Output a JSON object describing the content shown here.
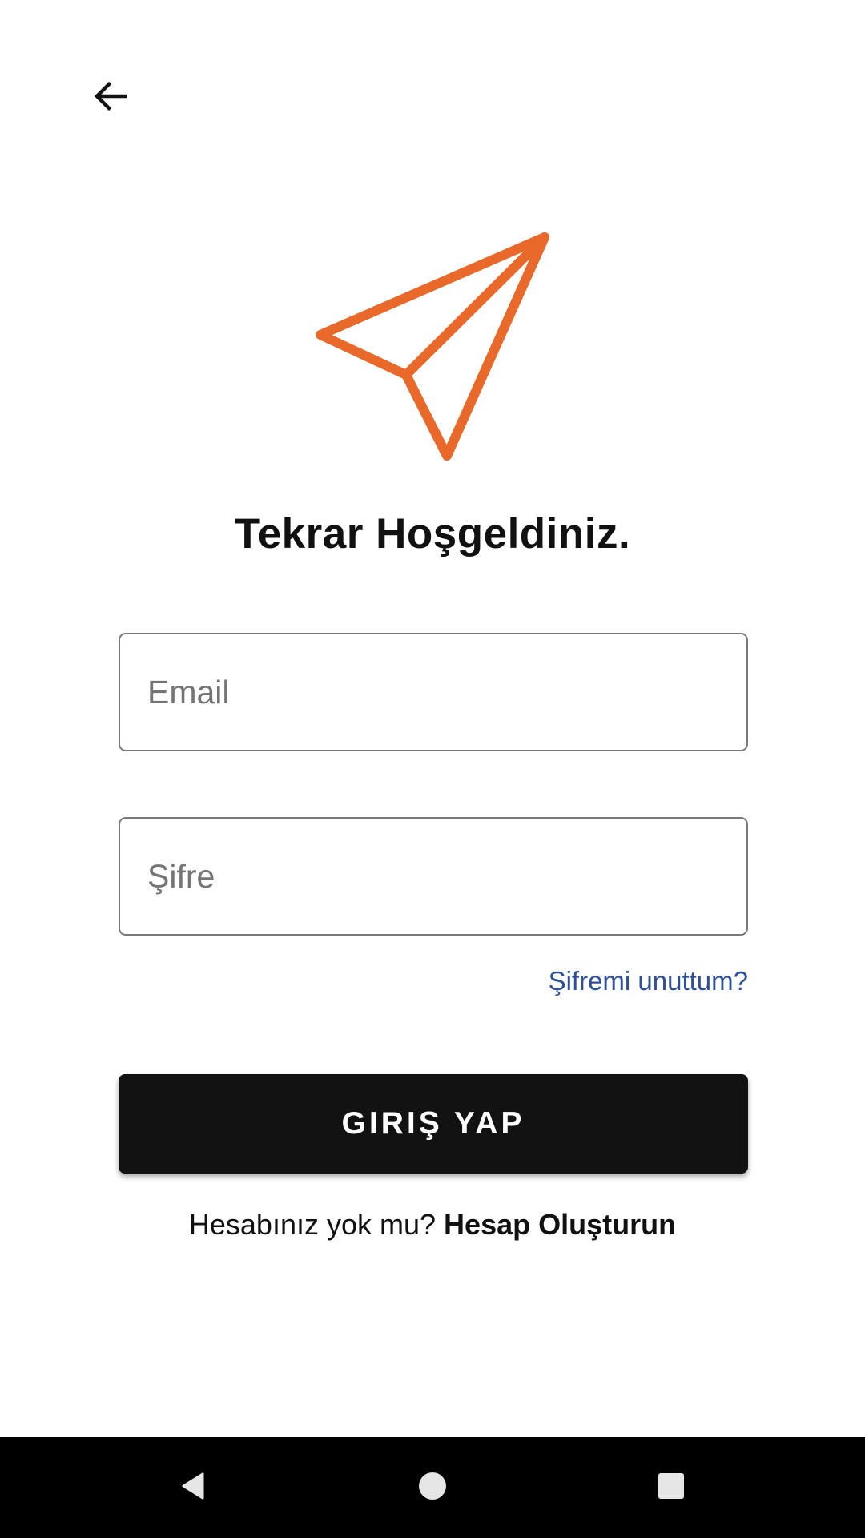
{
  "header": {
    "back_icon": "arrow-left-icon"
  },
  "logo": {
    "icon": "paper-plane-icon",
    "color": "#E8692A"
  },
  "title": "Tekrar Hoşgeldiniz.",
  "form": {
    "email_placeholder": "Email",
    "password_placeholder": "Şifre",
    "forgot_password": "Şifremi unuttum?",
    "login_button": "GIRIŞ YAP"
  },
  "signup": {
    "prompt": "Hesabınız yok mu? ",
    "link": "Hesap Oluşturun"
  },
  "nav": {
    "back_icon": "triangle-back-icon",
    "home_icon": "circle-home-icon",
    "recents_icon": "square-recents-icon"
  },
  "colors": {
    "accent": "#E8692A",
    "link": "#2E4F9A",
    "button": "#121212"
  }
}
